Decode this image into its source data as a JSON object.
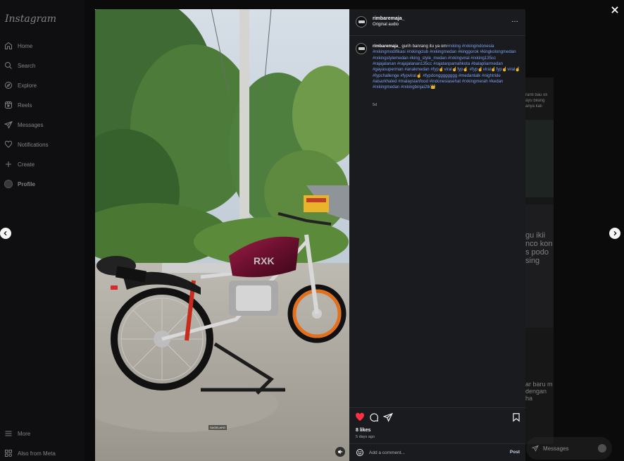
{
  "sidebar": {
    "logo": "Instagram",
    "items": [
      {
        "label": "Home",
        "icon": "home-icon"
      },
      {
        "label": "Search",
        "icon": "search-icon"
      },
      {
        "label": "Explore",
        "icon": "compass-icon"
      },
      {
        "label": "Reels",
        "icon": "reels-icon"
      },
      {
        "label": "Messages",
        "icon": "paper-plane-icon"
      },
      {
        "label": "Notifications",
        "icon": "heart-icon"
      },
      {
        "label": "Create",
        "icon": "plus-icon"
      },
      {
        "label": "Profile",
        "icon": "avatar"
      }
    ],
    "more": "More",
    "also_from_meta": "Also from Meta"
  },
  "background_feed": {
    "fragments": [
      "ranti bau oli",
      "ayu bilang",
      "anya kali",
      "gu ikii",
      "nco kon",
      "s podo",
      "sing",
      "ar baru m",
      "dengan",
      "ha"
    ],
    "messages_label": "Messages"
  },
  "post": {
    "username": "rimbaremaja_",
    "audio": "Original audio",
    "caption_text": "gurih banrang itu ya om",
    "hashtags": [
      "#rxking",
      "#rxkingindonesia",
      "#rxkingmodifikasi",
      "#rxkingclub",
      "#rxkingmedan",
      "#kinggorok",
      "#kingkolongmedan",
      "#rxkingstylemedan",
      "#king_style_medan",
      "#rxkingviral",
      "#rxking135cc",
      "#rajajalanan",
      "#rajajalanan135cc",
      "#rajatanpamahkota",
      "#balapliarmedan",
      "#gayasuperman",
      "#anakmedan",
      "#fyp☝viral☝fyp☝",
      "#fyp☝viral☝fyp☝viral☝",
      "#fypchallenge",
      "#fypviral☝",
      "#fypdongggggggg",
      "#medantalk",
      "#nightride",
      "#aisarkhaled",
      "#malaysianfood",
      "#indonesiasehat",
      "#rxkingmerah",
      "#kedan",
      "#rxkingmedan",
      "#rxkingbinjai2tk👑"
    ],
    "caption_time": "5d",
    "likes": "8 likes",
    "time_ago": "5 days ago",
    "comment_placeholder": "Add a comment...",
    "post_label": "Post",
    "watermark": "SAGELAHO"
  },
  "colors": {
    "hashtag": "#7aa0f5",
    "like_red": "#ff3040",
    "panel_bg": "#1a1b1f",
    "post_button": "#c9d4f5"
  }
}
